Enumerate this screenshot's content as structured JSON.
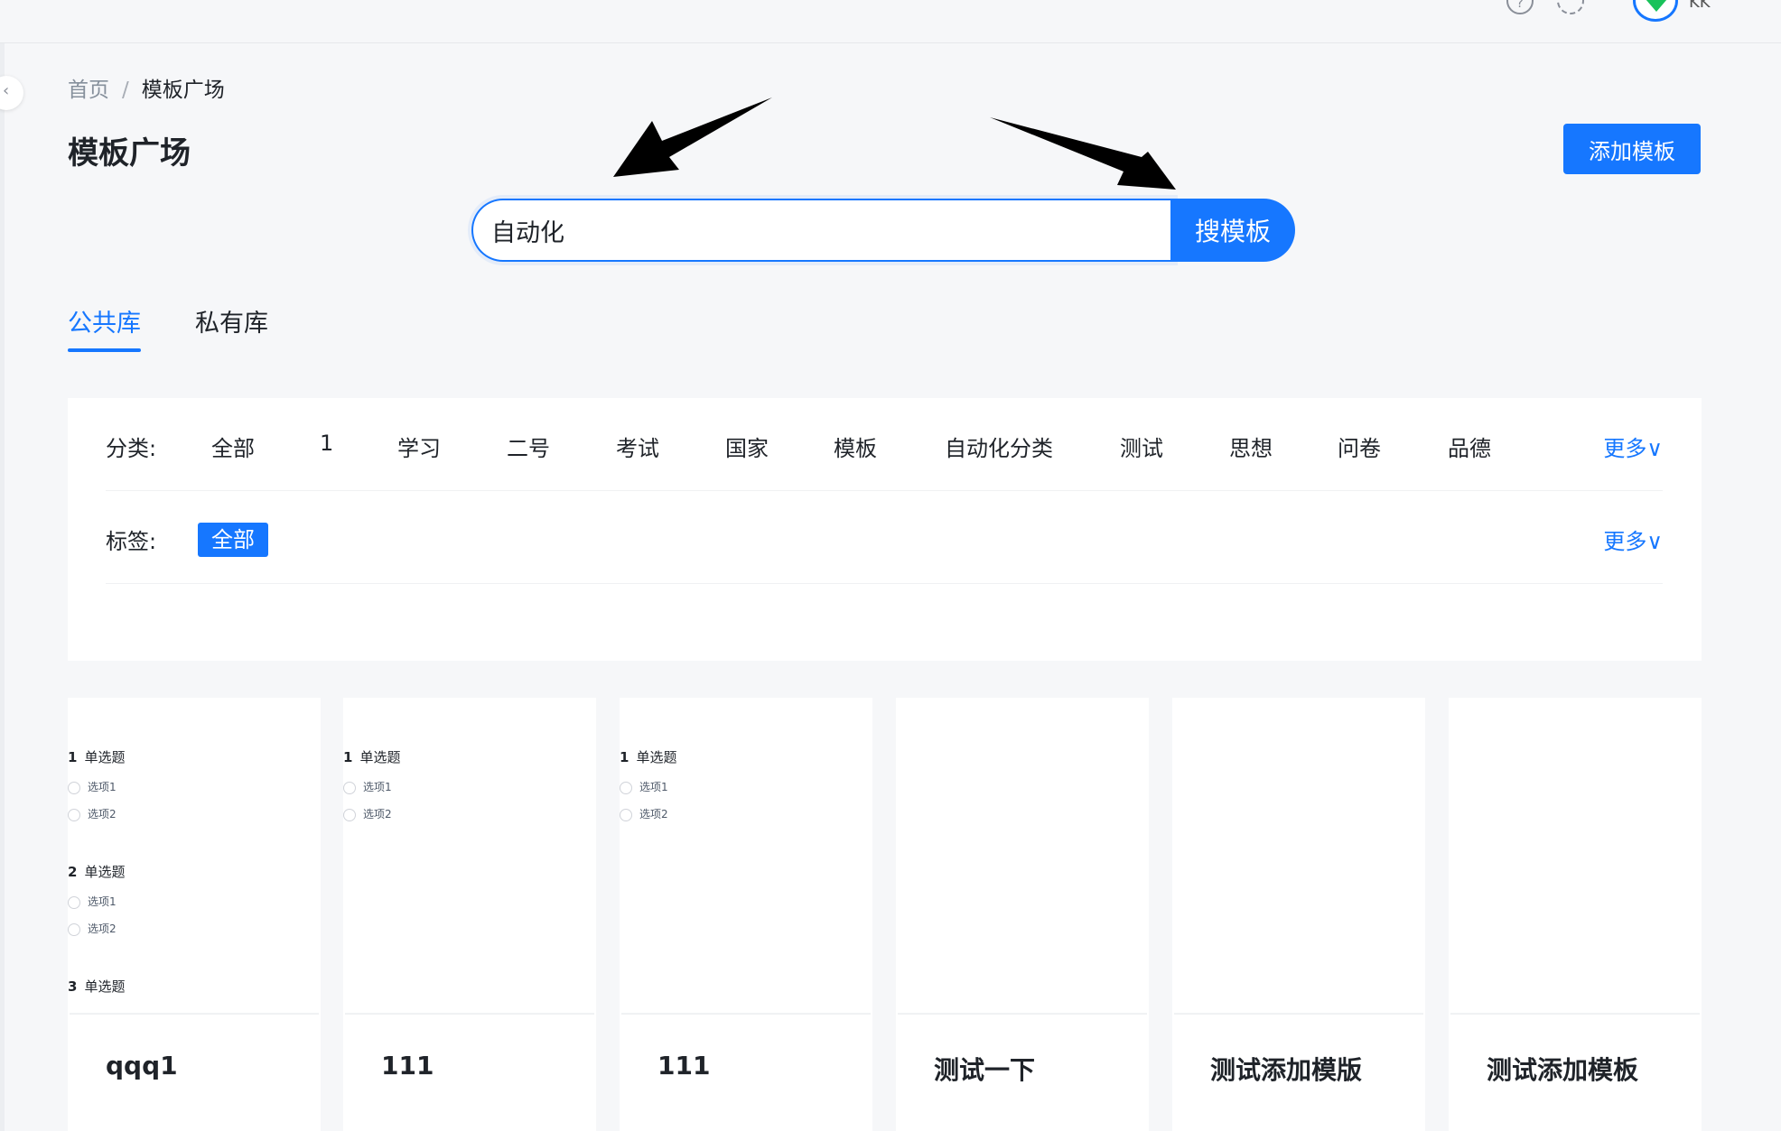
{
  "header": {
    "help_icon": "question-circle-icon",
    "help_glyph": "?",
    "settings_icon": "gear-icon",
    "user_name": "KK"
  },
  "breadcrumb": {
    "home": "首页",
    "separator": "/",
    "current": "模板广场"
  },
  "page": {
    "title": "模板广场",
    "add_button": "添加模板"
  },
  "search": {
    "value": "自动化",
    "button": "搜模板"
  },
  "tabs": [
    {
      "label": "公共库",
      "active": true
    },
    {
      "label": "私有库",
      "active": false
    }
  ],
  "filters": {
    "category_label": "分类:",
    "categories": [
      "全部",
      "1",
      "学习",
      "二号",
      "考试",
      "国家",
      "模板",
      "自动化分类",
      "测试",
      "思想",
      "问卷",
      "品德"
    ],
    "tag_label": "标签:",
    "tags": [
      "全部"
    ],
    "more_label": "更多∨"
  },
  "cards": [
    {
      "title": "qqq1",
      "preview": [
        {
          "num": "1",
          "type": "单选题",
          "options": [
            "选项1",
            "选项2"
          ]
        },
        {
          "num": "2",
          "type": "单选题",
          "options": [
            "选项1",
            "选项2"
          ]
        },
        {
          "num": "3",
          "type": "单选题",
          "options": []
        }
      ]
    },
    {
      "title": "111",
      "preview": [
        {
          "num": "1",
          "type": "单选题",
          "options": [
            "选项1",
            "选项2"
          ]
        }
      ]
    },
    {
      "title": "111",
      "preview": [
        {
          "num": "1",
          "type": "单选题",
          "options": [
            "选项1",
            "选项2"
          ]
        }
      ]
    },
    {
      "title": "测试一下",
      "preview": []
    },
    {
      "title": "测试添加模版",
      "preview": []
    },
    {
      "title": "测试添加模板",
      "preview": []
    }
  ],
  "colors": {
    "primary": "#1677ff",
    "background": "#f6f7f9"
  }
}
